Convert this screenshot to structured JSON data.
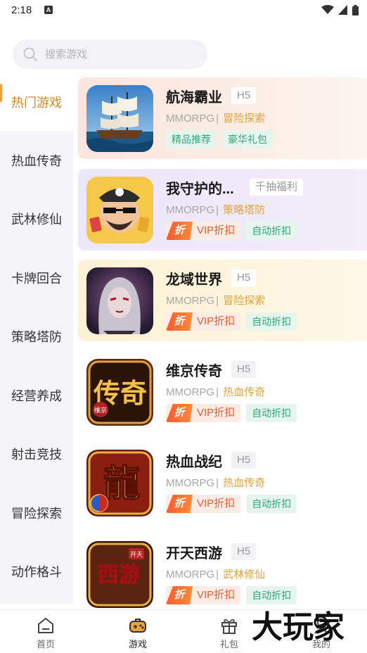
{
  "status_bar": {
    "time": "2:18",
    "notification_letter": "A"
  },
  "search": {
    "placeholder": "搜索游戏"
  },
  "sidebar": {
    "items": [
      {
        "label": "热门游戏",
        "active": true
      },
      {
        "label": "热血传奇",
        "active": false
      },
      {
        "label": "武林修仙",
        "active": false
      },
      {
        "label": "卡牌回合",
        "active": false
      },
      {
        "label": "策略塔防",
        "active": false
      },
      {
        "label": "经营养成",
        "active": false
      },
      {
        "label": "射击竞技",
        "active": false
      },
      {
        "label": "冒险探索",
        "active": false
      },
      {
        "label": "动作格斗",
        "active": false
      }
    ]
  },
  "games": [
    {
      "name": "航海霸业",
      "tag": "H5",
      "type": "MMORPG",
      "sep": "|",
      "genre": "冒险探索",
      "chips": [
        "精品推荐",
        "豪华礼包"
      ],
      "thumb_icon": "sailing-ship-icon"
    },
    {
      "name": "我守护的...",
      "tag": "千抽福利",
      "type": "MMORPG",
      "sep": "|",
      "genre": "策略塔防",
      "discount_badge": "折",
      "vip_label": "VIP折扣",
      "chip": "自动折扣",
      "thumb_icon": "pirate-character-icon"
    },
    {
      "name": "龙域世界",
      "tag": "H5",
      "type": "MMORPG",
      "sep": "|",
      "genre": "冒险探索",
      "discount_badge": "折",
      "vip_label": "VIP折扣",
      "chip": "自动折扣",
      "thumb_icon": "dark-queen-icon"
    },
    {
      "name": "维京传奇",
      "tag": "H5",
      "type": "MMORPG",
      "sep": "|",
      "genre": "热血传奇",
      "discount_badge": "折",
      "vip_label": "VIP折扣",
      "chip": "自动折扣",
      "thumb_icon": "legend-calligraphy-icon",
      "thumb_text": "传奇",
      "thumb_sub": "维京"
    },
    {
      "name": "热血战纪",
      "tag": "H5",
      "type": "MMORPG",
      "sep": "|",
      "genre": "热血传奇",
      "discount_badge": "折",
      "vip_label": "VIP折扣",
      "chip": "自动折扣",
      "thumb_icon": "dragon-character-icon",
      "thumb_text": "龍"
    },
    {
      "name": "开天西游",
      "tag": "H5",
      "type": "MMORPG",
      "sep": "|",
      "genre": "武林修仙",
      "discount_badge": "折",
      "vip_label": "VIP折扣",
      "chip": "自动折扣",
      "thumb_icon": "journey-west-icon",
      "thumb_text": "西游",
      "thumb_sub": "开天"
    }
  ],
  "bottom_nav": [
    {
      "label": "首页",
      "icon": "home-icon",
      "active": false
    },
    {
      "label": "游戏",
      "icon": "gamepad-icon",
      "active": true
    },
    {
      "label": "礼包",
      "icon": "gift-icon",
      "active": false
    },
    {
      "label": "我的",
      "icon": "profile-icon",
      "active": false
    }
  ],
  "watermark": {
    "text": "大玩家"
  },
  "colors": {
    "accent": "#f0a23a",
    "discount": "#ff5a2e",
    "chip_green": "#2fa877",
    "genre_orange": "#e5a23a"
  }
}
